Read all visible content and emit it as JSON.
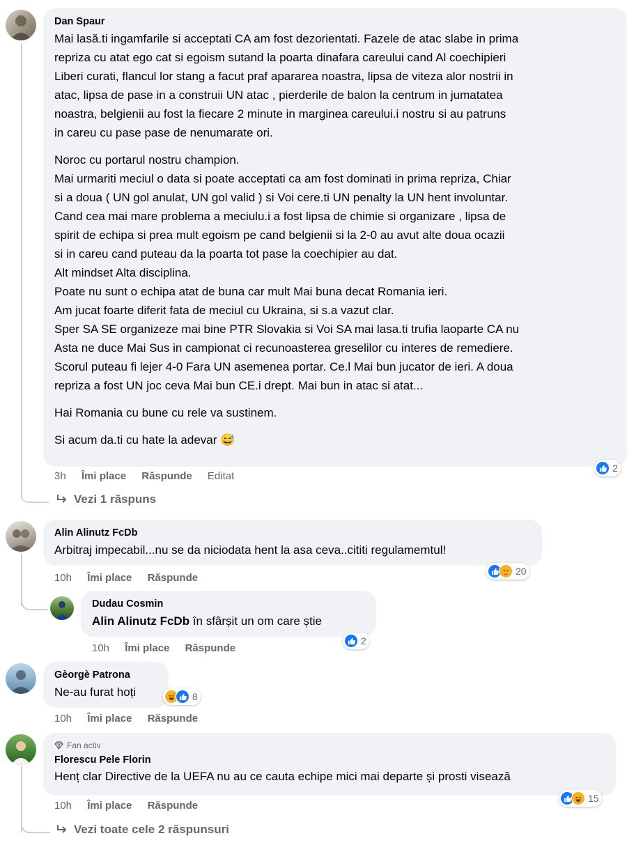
{
  "comments": [
    {
      "author": "Dan Spaur",
      "lines": [
        "Mai lasă.ti ingamfarile si acceptati CA am fost dezorientati. Fazele de atac slabe in prima",
        "repriza cu atat ego cat si egoism sutand la poarta dinafara careului cand Al coechipieri",
        "Liberi curati, flancul lor stang a facut praf apararea noastra, lipsa de viteza alor nostrii in",
        "atac, lipsa de pase in a construii UN atac , pierderile de balon la centrum in jumatatea",
        "noastra, belgienii au fost la fiecare 2 minute in marginea careului.i nostru si au patruns",
        "in careu cu pase pase de nenumarate ori.",
        "",
        "Noroc cu portarul nostru champion.",
        "Mai urmariti meciul o data si poate acceptati ca am fost dominati in prima repriza, Chiar",
        "si a doua ( UN gol anulat, UN gol valid ) si Voi cere.ti UN penalty la UN hent involuntar.",
        "Cand cea mai mare problema a meciulu.i a fost lipsa de chimie si organizare , lipsa de",
        "spirit de echipa si prea mult egoism pe cand belgienii si la 2-0 au avut alte doua ocazii",
        "si in careu cand puteau da la poarta tot pase la coechipier au dat.",
        "Alt mindset Alta disciplina.",
        "Poate nu sunt o echipa atat de buna car mult Mai buna decat Romania ieri.",
        "Am jucat foarte diferit fata de meciul cu Ukraina, si s.a vazut clar.",
        "Sper SA SE organizeze mai bine PTR Slovakia si Voi SA mai lasa.ti trufia laoparte CA nu",
        "Asta ne duce Mai Sus in campionat ci recunoasterea greselilor cu interes de remediere.",
        "Scorul puteau fi lejer 4-0 Fara UN asemenea portar. Ce.l Mai bun jucator de ieri. A doua",
        "repriza a fost UN joc ceva Mai bun CE.i drept. Mai bun in atac si atat...",
        "",
        "Hai Romania cu bune cu rele va sustinem.",
        "",
        "Si acum da.ti cu hate la adevar 😅"
      ],
      "time": "3h",
      "like_label": "Îmi place",
      "reply_label": "Răspunde",
      "edited_label": "Editat",
      "reaction_count": "2",
      "view_replies": "Vezi 1 răspuns"
    },
    {
      "author": "Alin Alinutz FcDb",
      "text": "Arbitraj impecabil...nu se da niciodata hent la asa ceva..cititi regulamemtul!",
      "time": "10h",
      "like_label": "Îmi place",
      "reply_label": "Răspunde",
      "reaction_count": "20"
    },
    {
      "author": "Dudau Cosmin",
      "mention": "Alin Alinutz FcDb",
      "text": " în sfârșit un om care știe",
      "time": "10h",
      "like_label": "Îmi place",
      "reply_label": "Răspunde",
      "reaction_count": "2"
    },
    {
      "author": "Gèorgè Patrona",
      "text": "Ne-au furat hoți",
      "time": "10h",
      "like_label": "Îmi place",
      "reply_label": "Răspunde",
      "reaction_count": "8"
    },
    {
      "badge": "Fan activ",
      "author": "Florescu Pele Florin",
      "text": "Henț clar Directive de la UEFA nu au ce cauta echipe mici mai departe și prosti visează",
      "time": "10h",
      "like_label": "Îmi place",
      "reply_label": "Răspunde",
      "reaction_count": "15",
      "view_replies": "Vezi toate cele 2 răspunsuri"
    }
  ],
  "colors": {
    "bubble": "#f0f2f5",
    "like": "#1877f2",
    "muted": "#65676b",
    "thread": "#ccd0d5"
  },
  "icons": [
    "like-icon",
    "haha-icon",
    "care-icon",
    "reply-arrow-icon",
    "diamond-icon"
  ]
}
